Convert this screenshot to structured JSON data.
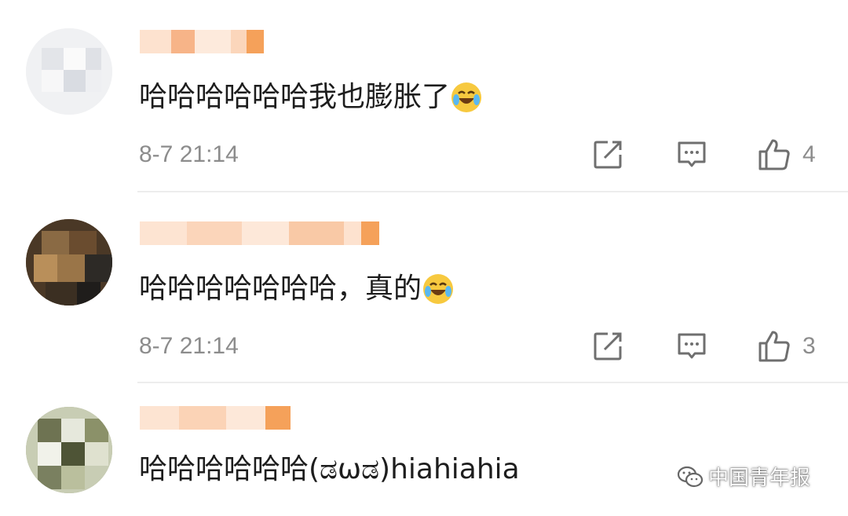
{
  "comments": [
    {
      "text": "哈哈哈哈哈哈我也膨胀了",
      "emoji": "laughing-tears-icon",
      "time": "8-7 21:14",
      "likes": "4"
    },
    {
      "text": "哈哈哈哈哈哈哈，真的",
      "emoji": "laughing-tears-icon",
      "time": "8-7 21:14",
      "likes": "3"
    },
    {
      "text": "哈哈哈哈哈哈(ಡωಡ)hiahiahia"
    }
  ],
  "actions": {
    "share_icon": "share-icon",
    "reply_icon": "comment-icon",
    "like_icon": "thumbs-up-icon"
  },
  "watermark": {
    "icon": "wechat-icon",
    "text": "中国青年报"
  },
  "colors": {
    "text": "#1d1d1d",
    "meta": "#8c8c8c",
    "icon": "#6f6f6f",
    "name_blur": "#f5a15a",
    "emoji": "#f7c93f"
  }
}
